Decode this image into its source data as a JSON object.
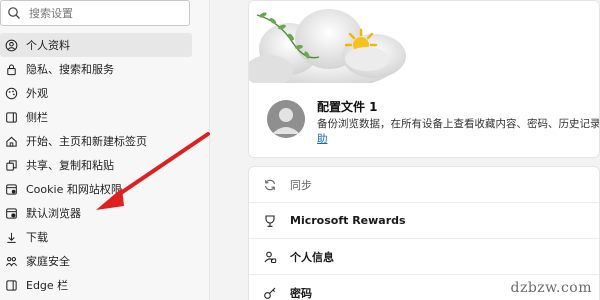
{
  "search": {
    "placeholder": "搜索设置",
    "icon": "search-icon"
  },
  "sidebar": {
    "items": [
      {
        "label": "个人资料",
        "icon": "person-icon",
        "active": true
      },
      {
        "label": "隐私、搜索和服务",
        "icon": "lock-icon"
      },
      {
        "label": "外观",
        "icon": "appearance-icon"
      },
      {
        "label": "侧栏",
        "icon": "sidebar-icon"
      },
      {
        "label": "开始、主页和新建标签页",
        "icon": "home-icon"
      },
      {
        "label": "共享、复制和粘贴",
        "icon": "share-icon"
      },
      {
        "label": "Cookie 和网站权限",
        "icon": "cookie-icon"
      },
      {
        "label": "默认浏览器",
        "icon": "browser-icon"
      },
      {
        "label": "下载",
        "icon": "download-icon"
      },
      {
        "label": "家庭安全",
        "icon": "family-icon"
      },
      {
        "label": "Edge 栏",
        "icon": "edge-bar-icon"
      }
    ]
  },
  "profile": {
    "name": "配置文件 1",
    "description": "备份浏览数据，在所有设备上查看收藏内容、密码、历史记录",
    "link_fragment": "助"
  },
  "settings": {
    "rows": [
      {
        "label": "同步",
        "icon": "sync-icon",
        "muted": true
      },
      {
        "label": "Microsoft Rewards",
        "icon": "rewards-icon"
      },
      {
        "label": "个人信息",
        "icon": "personal-info-icon"
      },
      {
        "label": "密码",
        "icon": "key-icon"
      }
    ]
  },
  "watermark": "dzbzw.com",
  "colors": {
    "accent": "#0f6cbd",
    "arrow": "#e02020",
    "active_bg": "#e7e7e7"
  }
}
